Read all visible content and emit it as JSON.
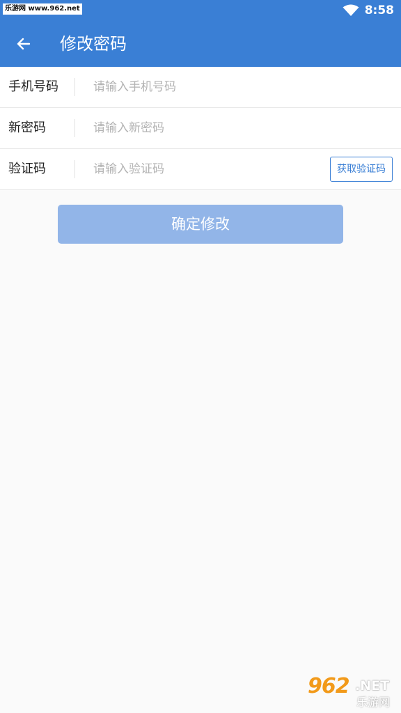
{
  "status_bar": {
    "watermark": "乐游网 www.962.net",
    "time": "8:58"
  },
  "header": {
    "title": "修改密码"
  },
  "form": {
    "phone": {
      "label": "手机号码",
      "placeholder": "请输入手机号码"
    },
    "new_password": {
      "label": "新密码",
      "placeholder": "请输入新密码"
    },
    "code": {
      "label": "验证码",
      "placeholder": "请输入验证码",
      "button": "获取验证码"
    }
  },
  "submit_label": "确定修改",
  "footer_watermark": {
    "number": "962",
    "suffix": ".NET",
    "name": "乐游网"
  },
  "colors": {
    "primary": "#3a7fd5",
    "button_disabled": "#92b5e8",
    "background": "#fafafa"
  },
  "icons": {
    "back": "arrow-left-icon",
    "wifi": "wifi-icon"
  }
}
